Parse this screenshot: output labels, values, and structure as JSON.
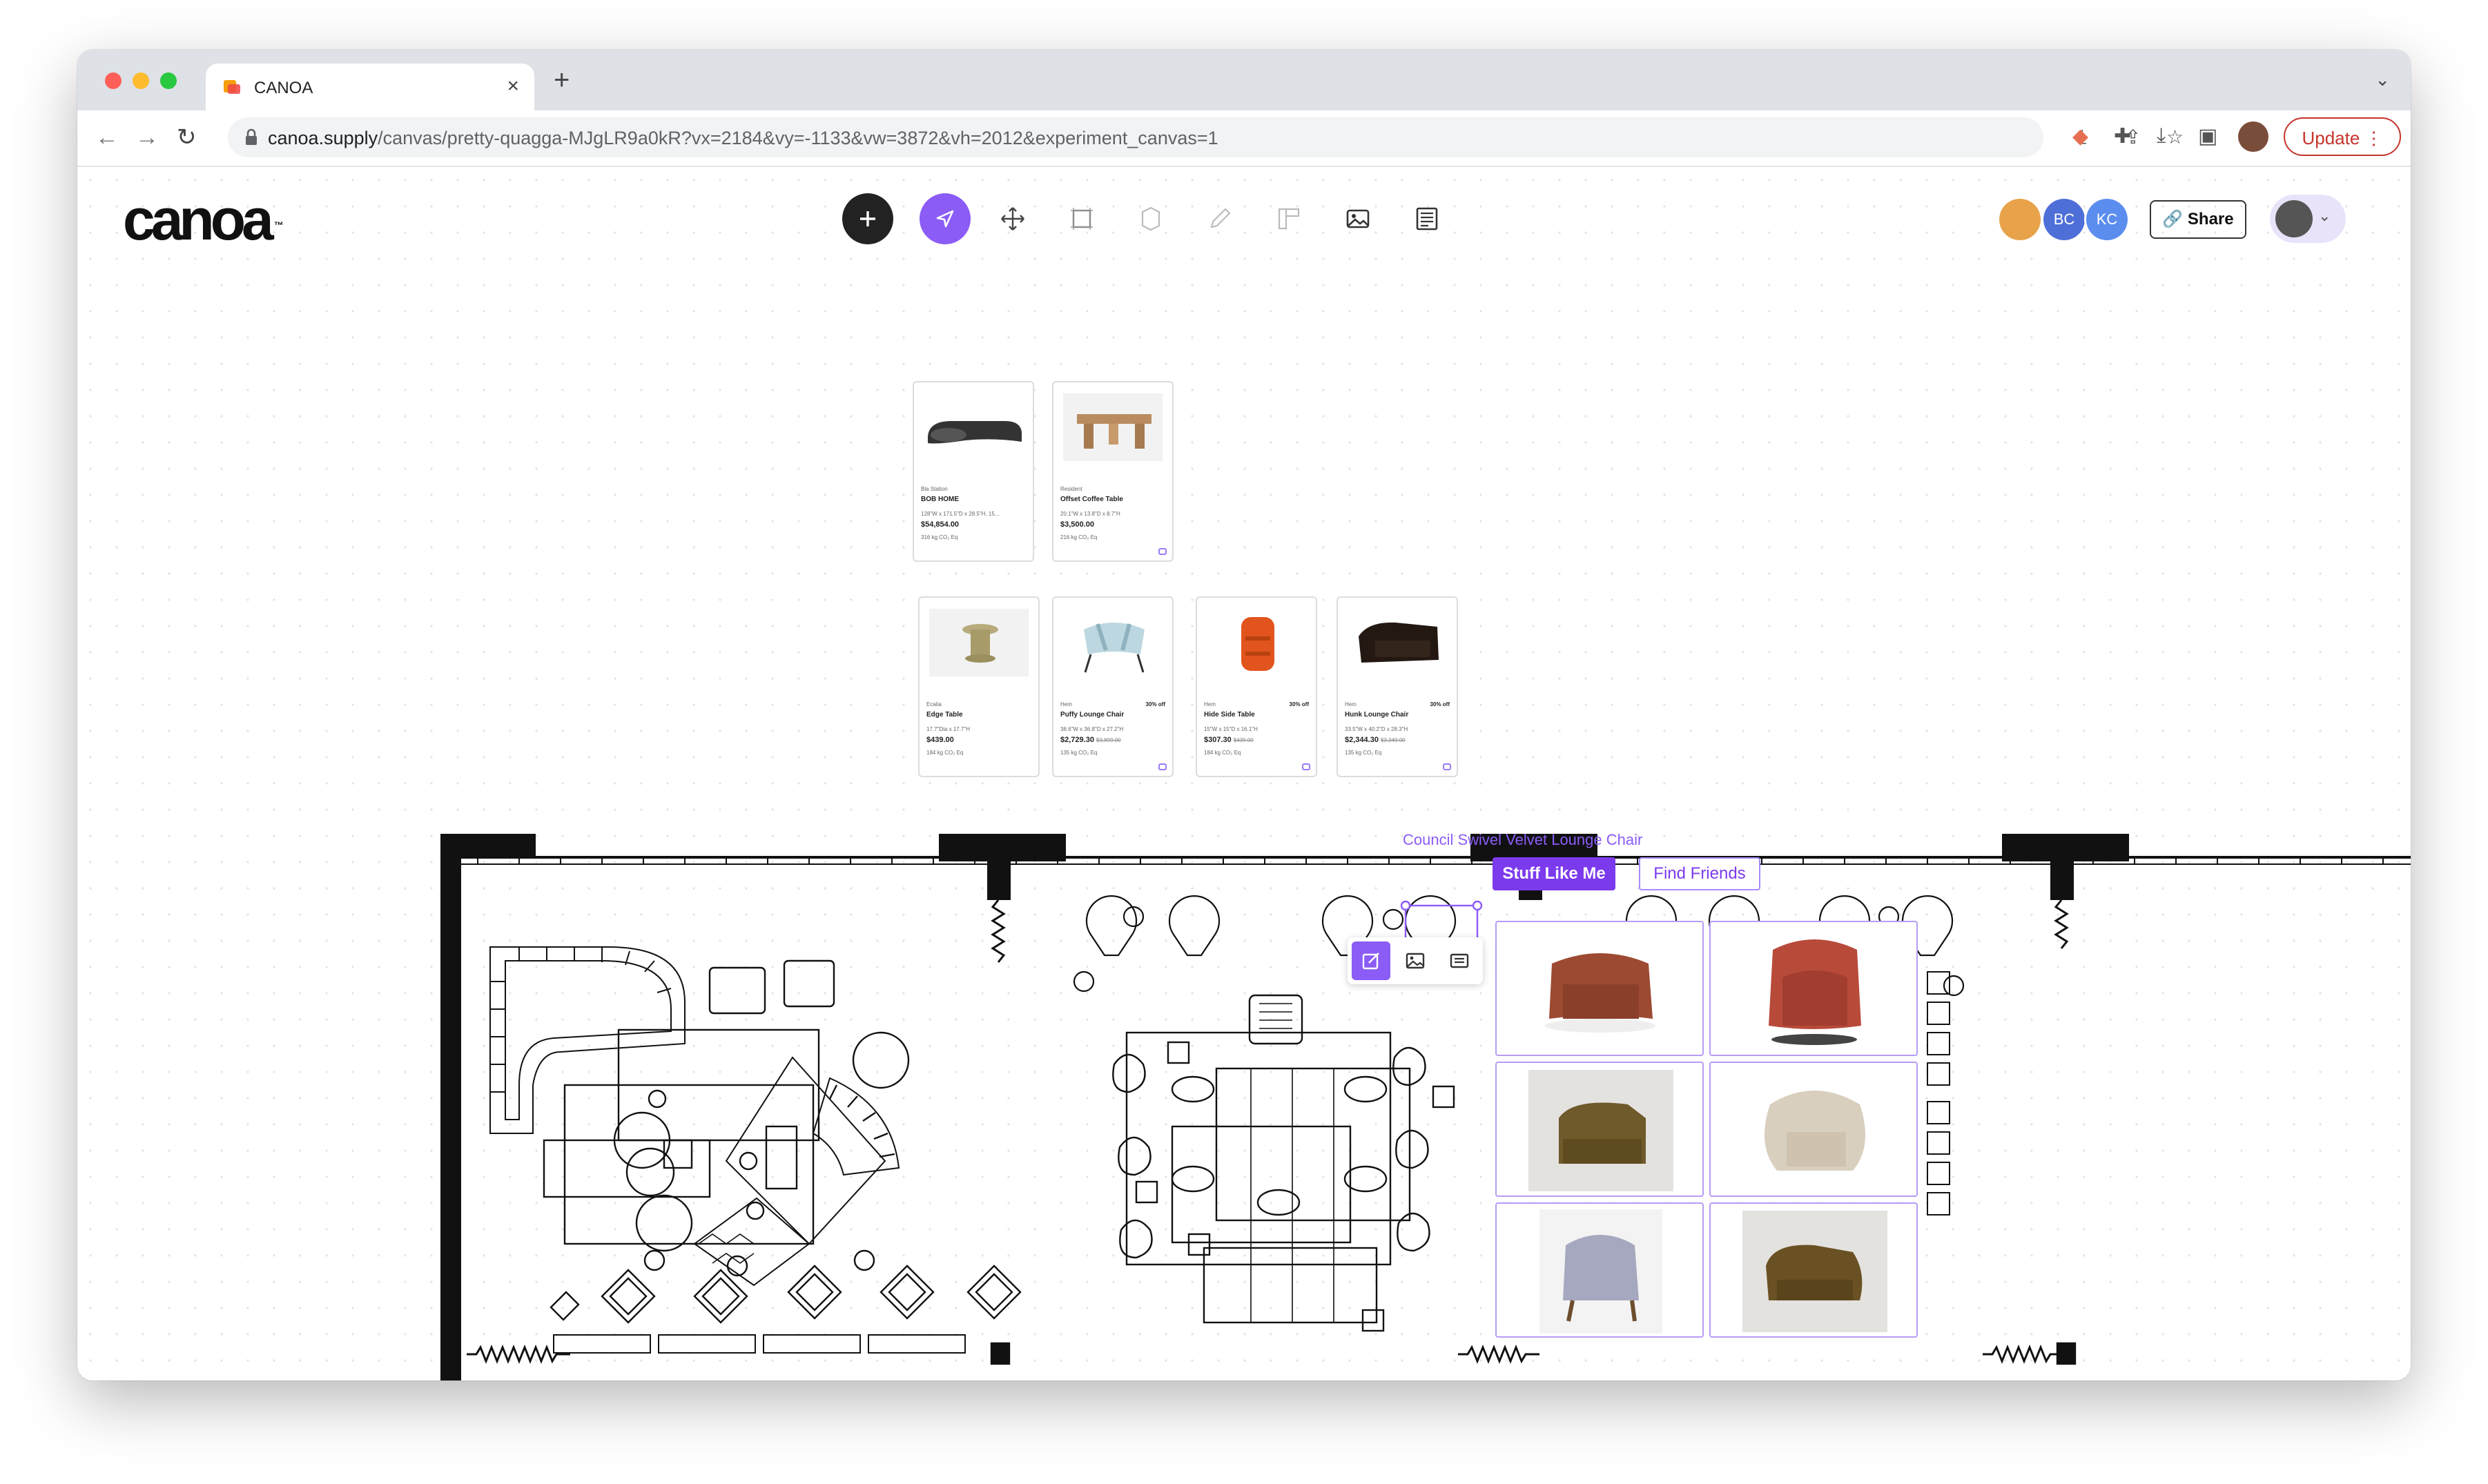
{
  "browser": {
    "tab_title": "CANOA",
    "url_host": "canoa.supply",
    "url_path": "/canvas/pretty-quagga-MJgLR9a0kR?vx=2184&vy=-1133&vw=3872&vh=2012&experiment_canvas=1",
    "update_label": "Update"
  },
  "app": {
    "logo_text": "canoa",
    "logo_mark": "™",
    "collaborators": [
      {
        "initials": "",
        "color": "#e8a24a"
      },
      {
        "initials": "BC",
        "color": "#4f6fd8"
      },
      {
        "initials": "KC",
        "color": "#5b8def"
      }
    ],
    "share_label": "Share"
  },
  "product_cards": [
    {
      "brand": "Bla Station",
      "name": "BOB HOME",
      "dims": "128\"W x 171.5\"D x 28.5\"H, 15...",
      "price": "$54,854.00",
      "was": "",
      "off": "",
      "co2": "316 kg CO₂ Eq"
    },
    {
      "brand": "Resident",
      "name": "Offset Coffee Table",
      "dims": "20.1\"W x 13.8\"D x 8.7\"H",
      "price": "$3,500.00",
      "was": "",
      "off": "",
      "co2": "216 kg CO₂ Eq"
    },
    {
      "brand": "Ecalia",
      "name": "Edge Table",
      "dims": "17.7\"Dia x 17.7\"H",
      "price": "$439.00",
      "was": "",
      "off": "",
      "co2": "184 kg CO₂ Eq"
    },
    {
      "brand": "Hem",
      "name": "Puffy Lounge Chair",
      "dims": "38.6\"W x 36.8\"D x 27.2\"H",
      "price": "$2,729.30",
      "was": "$3,899.00",
      "off": "30% off",
      "co2": "135 kg CO₂ Eq"
    },
    {
      "brand": "Hem",
      "name": "Hide Side Table",
      "dims": "15\"W x 15\"D x 16.1\"H",
      "price": "$307.30",
      "was": "$439.00",
      "off": "30% off",
      "co2": "184 kg CO₂ Eq"
    },
    {
      "brand": "Hem",
      "name": "Hunk Lounge Chair",
      "dims": "33.5\"W x 40.2\"D x 28.3\"H",
      "price": "$2,344.30",
      "was": "$3,349.00",
      "off": "30% off",
      "co2": "135 kg CO₂ Eq"
    }
  ],
  "selection": {
    "label": "Council Swivel Velvet Lounge Chair",
    "stuff_like_me": "Stuff Like Me",
    "find_friends": "Find Friends"
  },
  "similar_chairs": [
    {
      "color": "#9c4a32"
    },
    {
      "color": "#b84a3a"
    },
    {
      "color": "#6e5a2a"
    },
    {
      "color": "#d9cfbe"
    },
    {
      "color": "#a6a8bf"
    },
    {
      "color": "#6a5124"
    }
  ],
  "colors": {
    "accent": "#8b5cf6",
    "accent_dark": "#7c3aed",
    "update": "#c5352b"
  }
}
